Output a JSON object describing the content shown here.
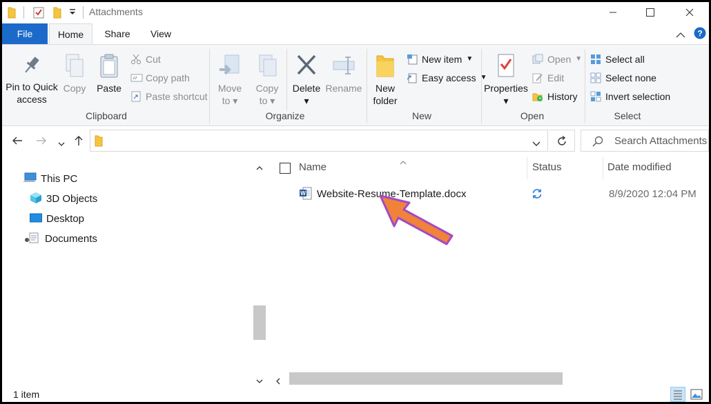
{
  "window": {
    "title": "Attachments",
    "controls": {
      "minimize": "—",
      "maximize": "☐",
      "close": "✕"
    }
  },
  "ribbon": {
    "tabs": [
      {
        "label": "File"
      },
      {
        "label": "Home"
      },
      {
        "label": "Share"
      },
      {
        "label": "View"
      }
    ],
    "clipboard": {
      "group_label": "Clipboard",
      "pin": [
        "Pin to Quick",
        "access"
      ],
      "copy": "Copy",
      "paste": "Paste",
      "cut": "Cut",
      "copy_path": "Copy path",
      "paste_shortcut": "Paste shortcut"
    },
    "organize": {
      "group_label": "Organize",
      "move_to": [
        "Move",
        "to"
      ],
      "copy_to": [
        "Copy",
        "to"
      ],
      "delete": "Delete",
      "rename": "Rename"
    },
    "new": {
      "group_label": "New",
      "new_folder": [
        "New",
        "folder"
      ],
      "new_item": "New item",
      "easy_access": "Easy access"
    },
    "open": {
      "group_label": "Open",
      "properties": "Properties",
      "open": "Open",
      "edit": "Edit",
      "history": "History"
    },
    "select": {
      "group_label": "Select",
      "select_all": "Select all",
      "select_none": "Select none",
      "invert_selection": "Invert selection"
    }
  },
  "address": {
    "path": "",
    "search_placeholder": "Search Attachments"
  },
  "nav_pane": {
    "items": [
      {
        "label": "This PC",
        "icon": "this-pc-icon"
      },
      {
        "label": "3D Objects",
        "icon": "3d-objects-icon"
      },
      {
        "label": "Desktop",
        "icon": "desktop-icon"
      },
      {
        "label": "Documents",
        "icon": "documents-icon"
      }
    ]
  },
  "file_list": {
    "columns": [
      "Name",
      "Status",
      "Date modified"
    ],
    "rows": [
      {
        "name": "Website-Resume-Template.docx",
        "status_icon": "sync-icon",
        "date_modified": "8/9/2020 12:04 PM",
        "icon": "word-doc-icon"
      }
    ]
  },
  "status_bar": {
    "item_count": "1 item"
  },
  "annotation": {
    "arrow_color": "#f0823a",
    "arrow_outline": "#a24bc4"
  },
  "colors": {
    "accent": "#1b6ac9",
    "folder": "#f5c542"
  }
}
